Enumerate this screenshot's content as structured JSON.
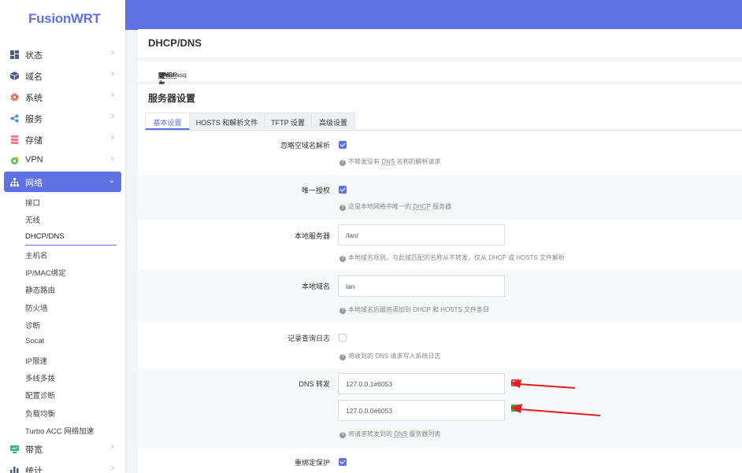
{
  "brand": "FusionWRT",
  "sidebar": {
    "items": [
      {
        "label": "状态",
        "icon": "dashboard-icon",
        "color": "#4a5d8c"
      },
      {
        "label": "域名",
        "icon": "cube-icon",
        "color": "#4a5d8c"
      },
      {
        "label": "系统",
        "icon": "gear-icon",
        "color": "#e25a3b"
      },
      {
        "label": "服务",
        "icon": "share-icon",
        "color": "#4a8fd6"
      },
      {
        "label": "存储",
        "icon": "storage-icon",
        "color": "#f07a8c"
      },
      {
        "label": "VPN",
        "icon": "vpn-icon",
        "color": "#5bbf57"
      }
    ],
    "active": {
      "label": "网络",
      "icon": "network-icon"
    },
    "subitems": [
      "接口",
      "无线",
      "DHCP/DNS",
      "主机名",
      "IP/MAC绑定",
      "静态路由",
      "防火墙",
      "诊断",
      "Socat",
      "IP限速",
      "多线多拨",
      "配置诊断",
      "负载均衡",
      "Turbo ACC 网络加速"
    ],
    "selected_sub": "DHCP/DNS",
    "after": [
      {
        "label": "带宽",
        "icon": "bandwidth-icon",
        "color": "#2fb38a"
      },
      {
        "label": "统计",
        "icon": "stats-icon",
        "color": "#4a5d8c"
      }
    ]
  },
  "page": {
    "title": "DHCP/DNS",
    "desc_parts": [
      "Dnsmasq 为 ",
      "NAT",
      " 防火墙提供了一个集成的 ",
      "DHCP",
      " 服务器和 ",
      "DNS",
      " 转发器"
    ]
  },
  "section": {
    "title": "服务器设置",
    "tabs": [
      "基本设置",
      "HOSTS 和解析文件",
      "TFTP 设置",
      "高级设置"
    ],
    "active_tab": 0
  },
  "fields": {
    "domainneeded": {
      "label": "忽略空域名解析",
      "checked": true,
      "help": [
        "不转发没有 ",
        "DNS",
        " 名称的解析请求"
      ]
    },
    "authoritative": {
      "label": "唯一授权",
      "checked": true,
      "help": [
        "这是本地网络中唯一的 ",
        "DHCP",
        " 服务器"
      ]
    },
    "local": {
      "label": "本地服务器",
      "value": "/lan/",
      "help": "本地域名规则。与此域匹配的名称从不转发，仅从 DHCP 或 HOSTS 文件解析"
    },
    "domain": {
      "label": "本地域名",
      "value": "lan",
      "help": "本地域名后缀将添加到 DHCP 和 HOSTS 文件条目"
    },
    "logqueries": {
      "label": "记录查询日志",
      "checked": false,
      "help": "将收到的 DNS 请求写入系统日志"
    },
    "dns_forward": {
      "label": "DNS 转发",
      "values": [
        "127.0.0.1#6053",
        "127.0.0.0#6053"
      ],
      "help": [
        "将请求转发到的 ",
        "DNS",
        " 服务器列表"
      ]
    },
    "rebind": {
      "label": "重绑定保护",
      "checked": true
    }
  },
  "colors": {
    "accent": "#5e72e4",
    "arrow": "#e02020",
    "remove": "#e04040",
    "add": "#3aa53a"
  }
}
